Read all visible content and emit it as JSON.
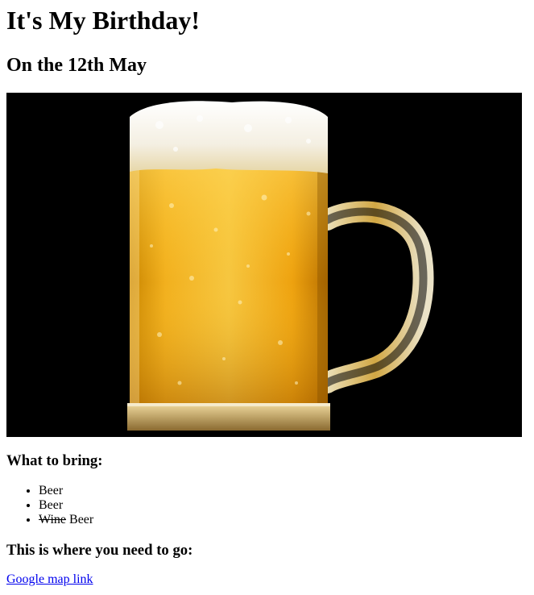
{
  "page": {
    "title": "It's My Birthday!",
    "date_heading": "On the 12th May"
  },
  "hero_image": {
    "description_icon": "beer-mug-image"
  },
  "bring": {
    "heading": "What to bring:",
    "items": [
      {
        "strike": "",
        "text": "Beer"
      },
      {
        "strike": "",
        "text": "Beer"
      },
      {
        "strike": "Wine",
        "text": " Beer"
      }
    ]
  },
  "directions": {
    "heading": "This is where you need to go:",
    "link_label": "Google map link"
  },
  "colors": {
    "link": "#0000ee",
    "image_background": "#000000",
    "beer": "#f2b01e",
    "foam": "#f7f3ea"
  }
}
